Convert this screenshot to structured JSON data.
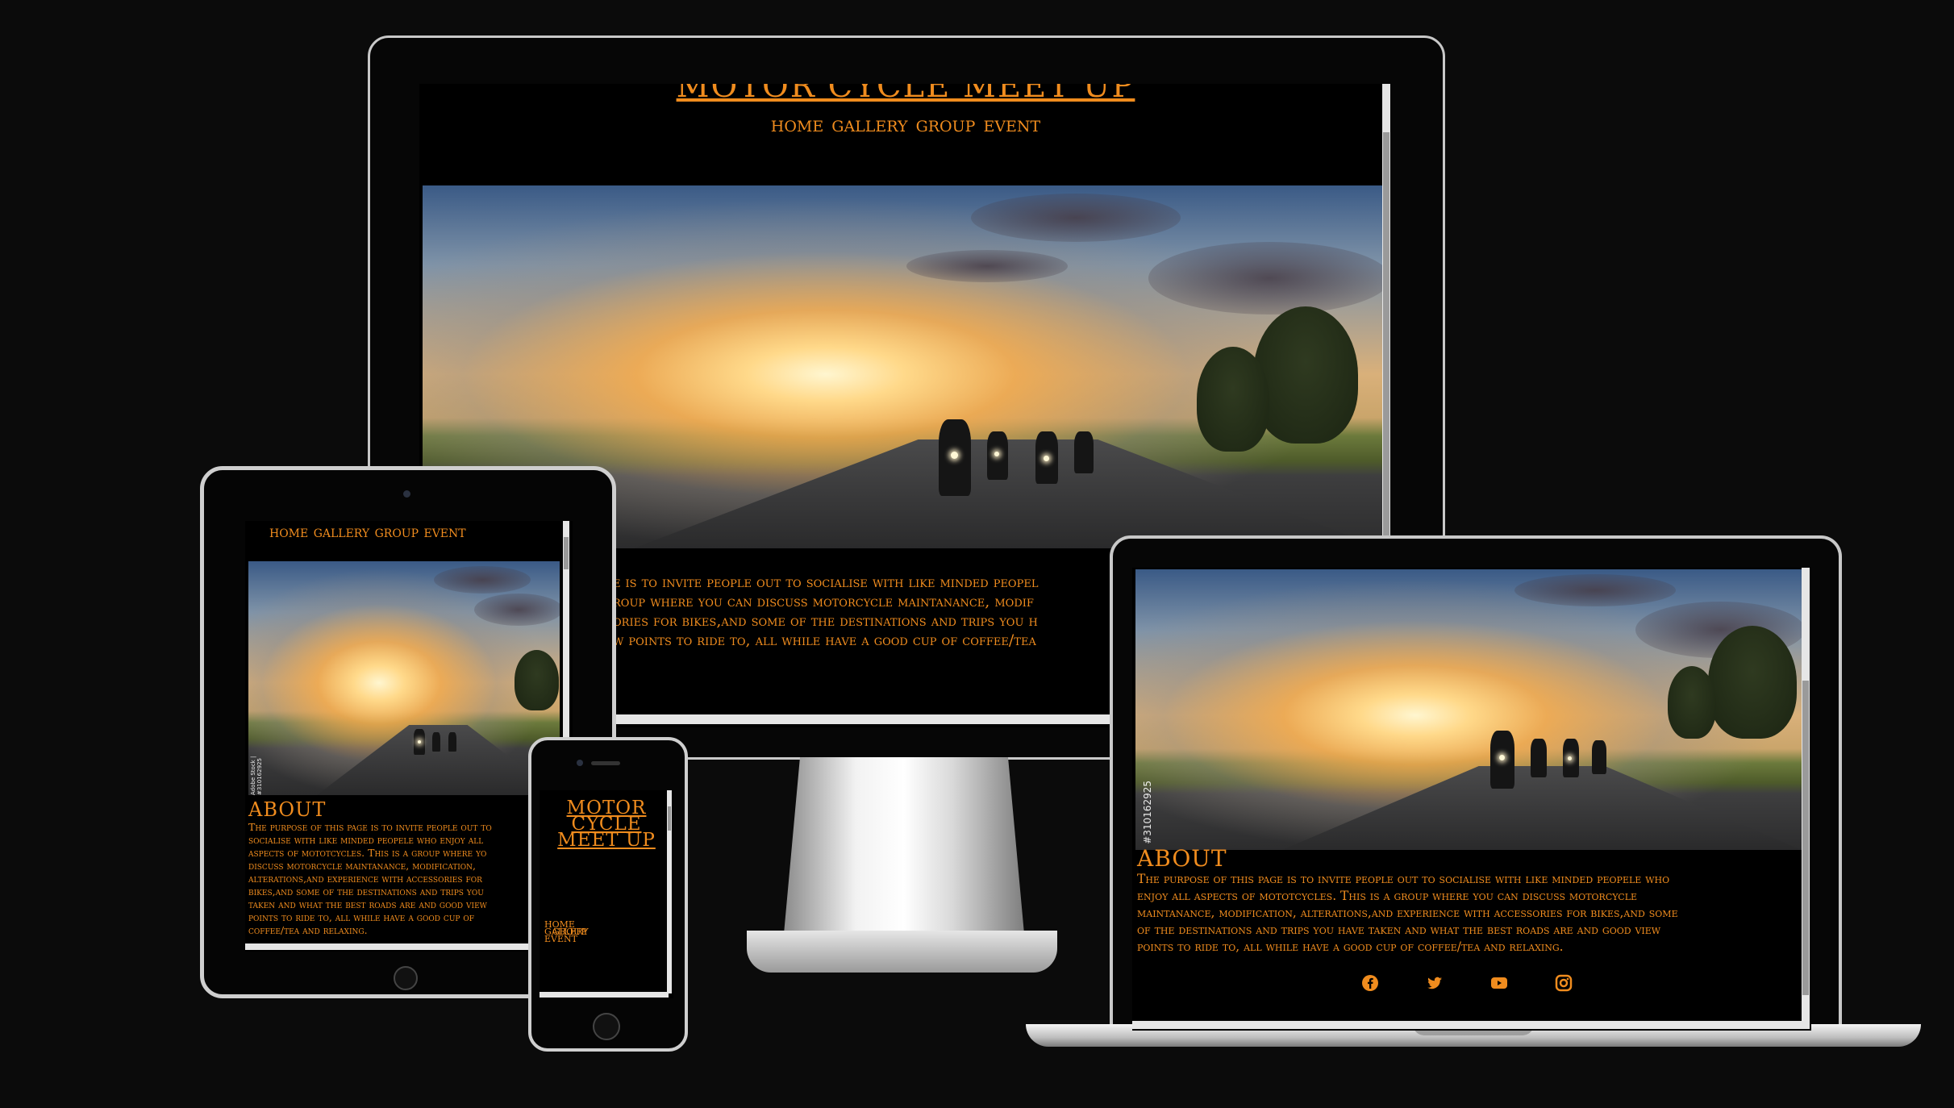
{
  "site": {
    "title": "MOTOR CYCLE MEET UP",
    "title_lines": [
      "MOTOR",
      "CYCLE",
      "MEET UP"
    ],
    "nav": [
      "HOME",
      "GALLERY",
      "GROUP",
      "EVENT"
    ],
    "nav_line": "HOME GALLERY GROUP EVENT",
    "about_heading": "ABOUT",
    "about_text": "The purpose of this page is to invite people out to socialise with like minded peopele who enjoy all aspects of mototcycles. This is a group where you can discuss motorcycle maintanance, modification, alterations,and experience with accessories for bikes,and some of the destinations and trips you have taken and what the best roads are and good view points to ride to, all while have a good cup of coffee/tea and relaxing.",
    "desktop_about_fragment": [
      "e is to invite people out to socialise with like minded peopel",
      "roup where you can discuss motorcycle maintanance, modif",
      "ories for bikes,and some of the destinations and trips you h",
      "w points to ride to, all while have a good cup of coffee/tea"
    ],
    "tablet_about_lines": [
      "The purpose of this page is to invite people out to",
      "socialise with like minded peopele who enjoy all",
      "aspects of mototcycles. This is a group where yo",
      "discuss motorcycle maintanance, modification,",
      "alterations,and experience with accessories for",
      "bikes,and some of the destinations and trips you",
      "taken and what the best roads are and good view",
      "points to ride to, all while have a good cup of",
      "coffee/tea and relaxing."
    ],
    "laptop_about_lines": [
      "The purpose of this page is to invite people out to socialise with like minded peopele who",
      "enjoy all aspects of mototcycles. This is a group where you can discuss motorcycle",
      "maintanance, modification, alterations,and experience with accessories for bikes,and some",
      "of the destinations and trips you have taken and what the best roads are and good view",
      "points to ride to, all while have a good cup of coffee/tea and relaxing."
    ],
    "phone_nav_lines": [
      "HOME",
      "GALLERY",
      "GROUP",
      "EVENT"
    ],
    "stock_id": "#310162925",
    "stock_small": "Adobe Stock | #310162925",
    "social_icons": [
      "facebook-icon",
      "twitter-icon",
      "youtube-icon",
      "instagram-icon"
    ]
  },
  "colors": {
    "accent": "#f08c1e",
    "background": "#0b0b0b",
    "screen": "#000000"
  }
}
